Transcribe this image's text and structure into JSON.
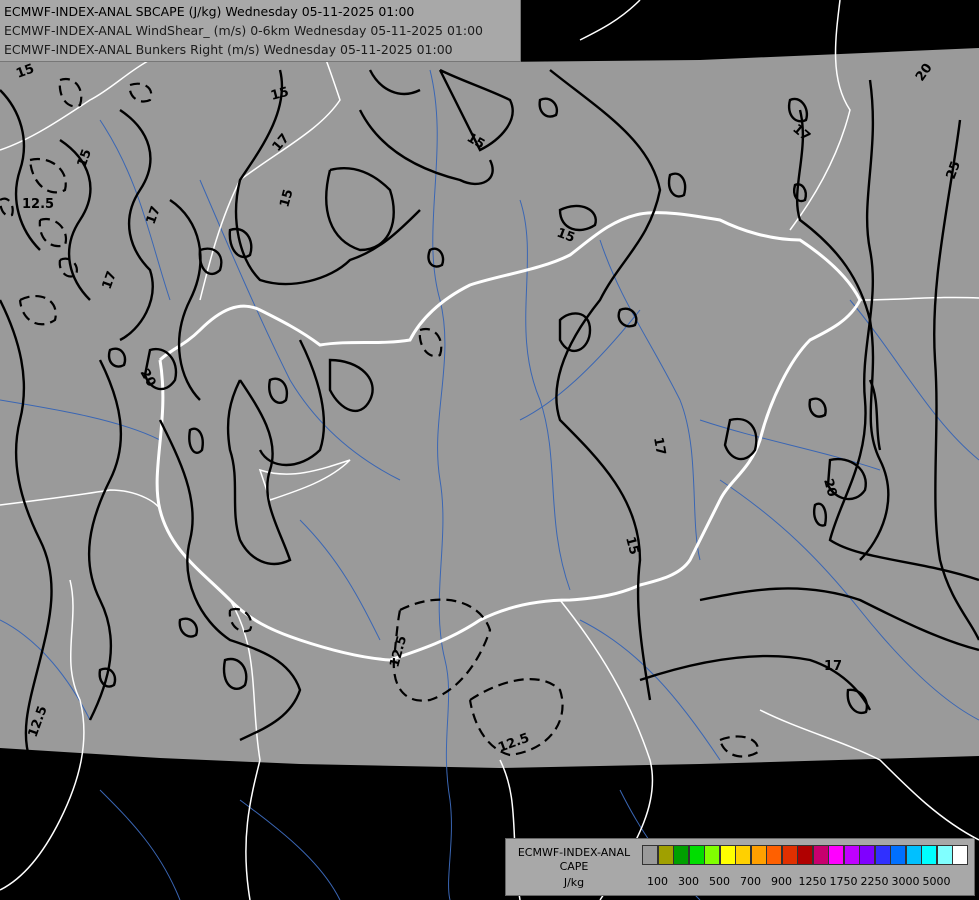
{
  "header": {
    "line1": "ECMWF-INDEX-ANAL SBCAPE (J/kg) Wednesday 05-11-2025 01:00",
    "line2": "ECMWF-INDEX-ANAL WindShear_ (m/s) 0-6km Wednesday 05-11-2025 01:00",
    "line3": "ECMWF-INDEX-ANAL Bunkers Right (m/s) Wednesday 05-11-2025 01:00"
  },
  "colors": {
    "background": "#000000",
    "domain_fill": "#9a9a9a",
    "border_line": "#ffffff",
    "river_line": "#3a66b4",
    "contour_line": "#000000"
  },
  "legend": {
    "title1": "ECMWF-INDEX-ANAL",
    "title2": "CAPE",
    "title3": "J/kg",
    "swatches": [
      "#9a9a9a",
      "#a0a000",
      "#00a000",
      "#00dd00",
      "#80ff00",
      "#ffff00",
      "#ffd000",
      "#ffa000",
      "#ff6000",
      "#e03000",
      "#b00000",
      "#c8006e",
      "#ff00ff",
      "#c000ff",
      "#8000ff",
      "#3030ff",
      "#0070ff",
      "#00c0ff",
      "#00ffff",
      "#80ffff",
      "#ffffff"
    ],
    "ticks": [
      "100",
      "300",
      "500",
      "700",
      "900",
      "1250",
      "1750",
      "2250",
      "3000",
      "5000"
    ]
  },
  "contour_labels": [
    {
      "id": "c-15-a",
      "text": "15"
    },
    {
      "id": "c-15-b",
      "text": "15"
    },
    {
      "id": "c-15-c",
      "text": "15"
    },
    {
      "id": "c-15-d",
      "text": "15"
    },
    {
      "id": "c-15-e",
      "text": "15"
    },
    {
      "id": "c-15-f",
      "text": "15"
    },
    {
      "id": "c-15-g",
      "text": "15"
    },
    {
      "id": "c-17-a",
      "text": "17"
    },
    {
      "id": "c-17-b",
      "text": "17"
    },
    {
      "id": "c-17-c",
      "text": "17"
    },
    {
      "id": "c-17-d",
      "text": "17"
    },
    {
      "id": "c-17-e",
      "text": "17"
    },
    {
      "id": "c-17-f",
      "text": "17"
    },
    {
      "id": "c-20-a",
      "text": "20"
    },
    {
      "id": "c-20-b",
      "text": "20"
    },
    {
      "id": "c-20-c",
      "text": "20"
    },
    {
      "id": "c-25-a",
      "text": "25"
    },
    {
      "id": "c-125-a",
      "text": "12.5"
    },
    {
      "id": "c-125-b",
      "text": "12.5"
    },
    {
      "id": "c-125-c",
      "text": "12.5"
    },
    {
      "id": "c-125-d",
      "text": "12.5"
    }
  ]
}
